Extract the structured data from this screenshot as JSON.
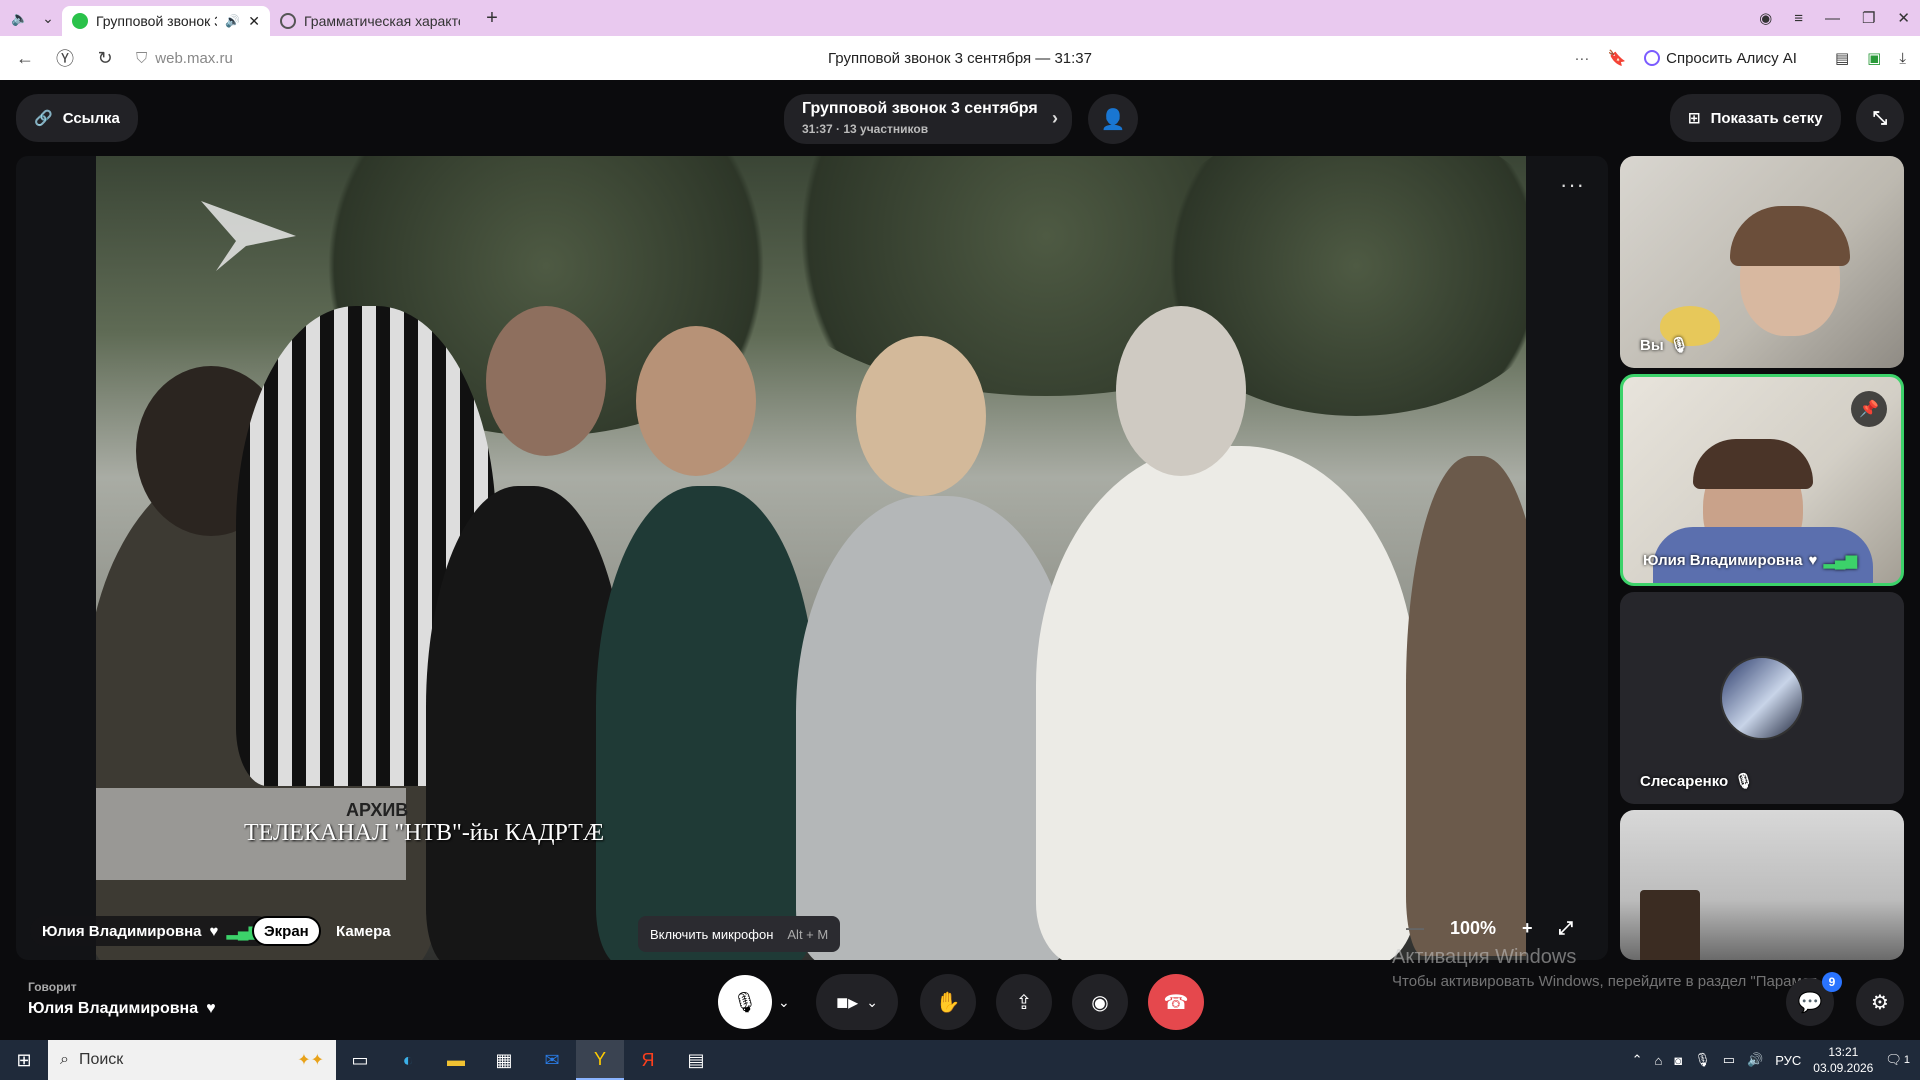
{
  "browser": {
    "tabs": [
      {
        "label": "Групповой звонок 3",
        "active": true
      },
      {
        "label": "Грамматическая характе",
        "active": false
      }
    ],
    "url": "web.max.ru",
    "page_title": "Групповой звонок 3 сентября — 31:37",
    "alice_label": "Спросить Алису AI",
    "new_tab": "+"
  },
  "header": {
    "link_label": "Ссылка",
    "call_title": "Групповой звонок 3 сентября",
    "call_meta": "31:37 · 13 участников",
    "grid_label": "Показать сетку"
  },
  "stage": {
    "caption_top": "АРХИВ",
    "caption_main": "ТЕЛЕКАНАЛ \"НТВ\"-йы КАДРТÆ",
    "sharer_name": "Юлия Владимировна",
    "view_screen": "Экран",
    "view_camera": "Камера",
    "zoom": "100%",
    "more": "···"
  },
  "participants": [
    {
      "name": "Вы",
      "muted": true
    },
    {
      "name": "Юлия Владимировна",
      "muted": false,
      "speaking": true
    },
    {
      "name": "Слесаренко",
      "muted": true
    },
    {
      "name": "",
      "muted": false
    }
  ],
  "footer": {
    "speaking_label": "Говорит",
    "speaking_name": "Юлия Владимировна",
    "tooltip_text": "Включить микрофон",
    "tooltip_shortcut": "Alt + M",
    "chat_badge": "9",
    "windows_activation_title": "Активация Windows",
    "windows_activation_text": "Чтобы активировать Windows, перейдите в раздел \"Парамет"
  },
  "taskbar": {
    "search_placeholder": "Поиск",
    "lang": "РУС",
    "time": "13:21",
    "date": "03.09.2026",
    "notif_count": "1"
  },
  "colors": {
    "tab_strip": "#e9c9ef",
    "speaking_border": "#3cd26a",
    "hangup": "#e5484d",
    "badge": "#2a74ff"
  }
}
